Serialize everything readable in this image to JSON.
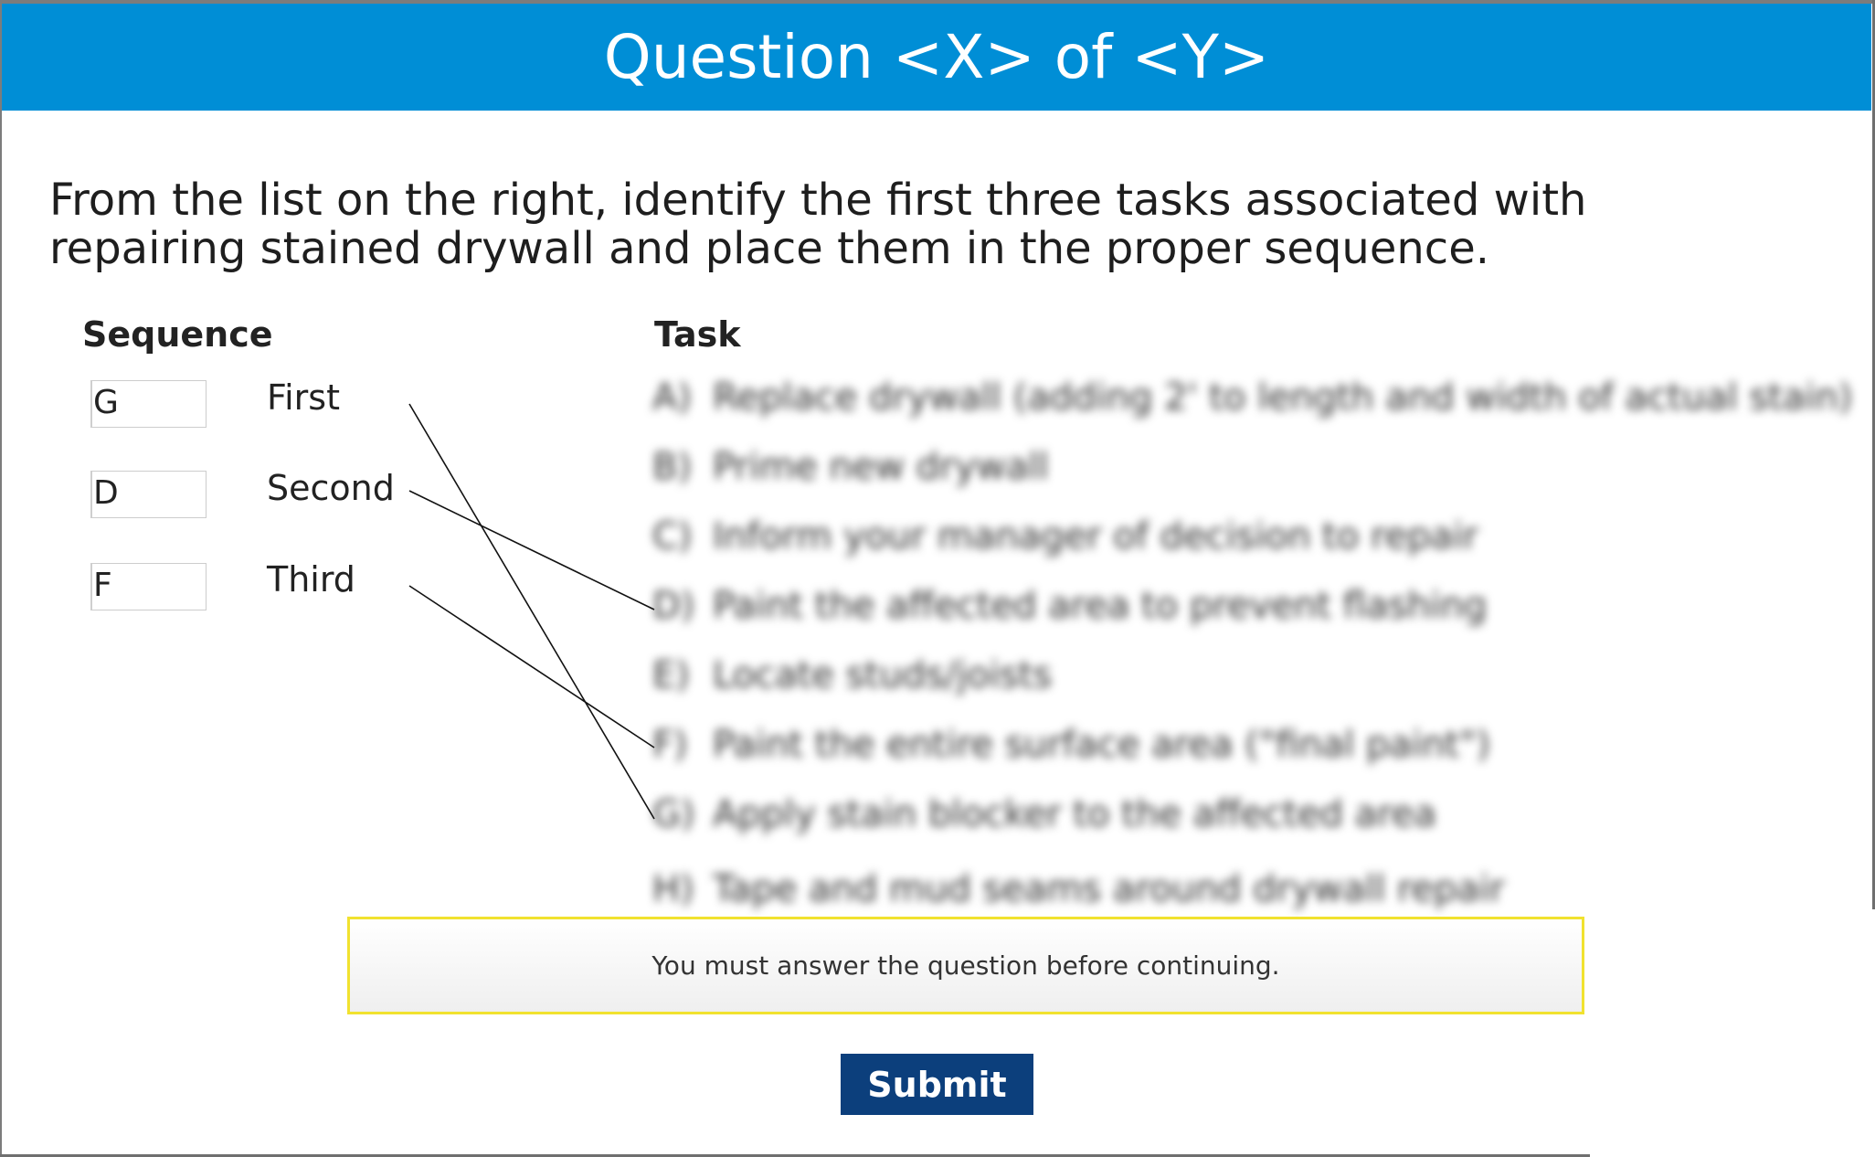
{
  "header": {
    "title": "Question <X> of <Y>"
  },
  "question": {
    "prompt": "From the list on the right, identify the first three tasks associated with repairing stained drywall and place them in the proper sequence."
  },
  "columns": {
    "sequence_heading": "Sequence",
    "task_heading": "Task"
  },
  "sequence": [
    {
      "answer": "G",
      "label": "First"
    },
    {
      "answer": "D",
      "label": "Second"
    },
    {
      "answer": "F",
      "label": "Third"
    }
  ],
  "tasks": [
    {
      "letter": "A)",
      "text": "Replace drywall (adding 2' to length and width of actual stain)"
    },
    {
      "letter": "B)",
      "text": "Prime new drywall"
    },
    {
      "letter": "C)",
      "text": "Inform your manager of decision to repair"
    },
    {
      "letter": "D)",
      "text": "Paint the affected area to prevent flashing"
    },
    {
      "letter": "E)",
      "text": "Locate studs/joists"
    },
    {
      "letter": "F)",
      "text": "Paint the entire surface area (\"final paint\")"
    },
    {
      "letter": "G)",
      "text": "Apply stain blocker to the affected area"
    },
    {
      "letter": "H)",
      "text": "Tape and mud seams around drywall repair"
    }
  ],
  "alert": {
    "message": "You must answer the question before continuing."
  },
  "submit": {
    "label": "Submit"
  },
  "colors": {
    "header": "#008ed6",
    "submit": "#0c3f7c",
    "alert_border": "#f1e22f"
  }
}
